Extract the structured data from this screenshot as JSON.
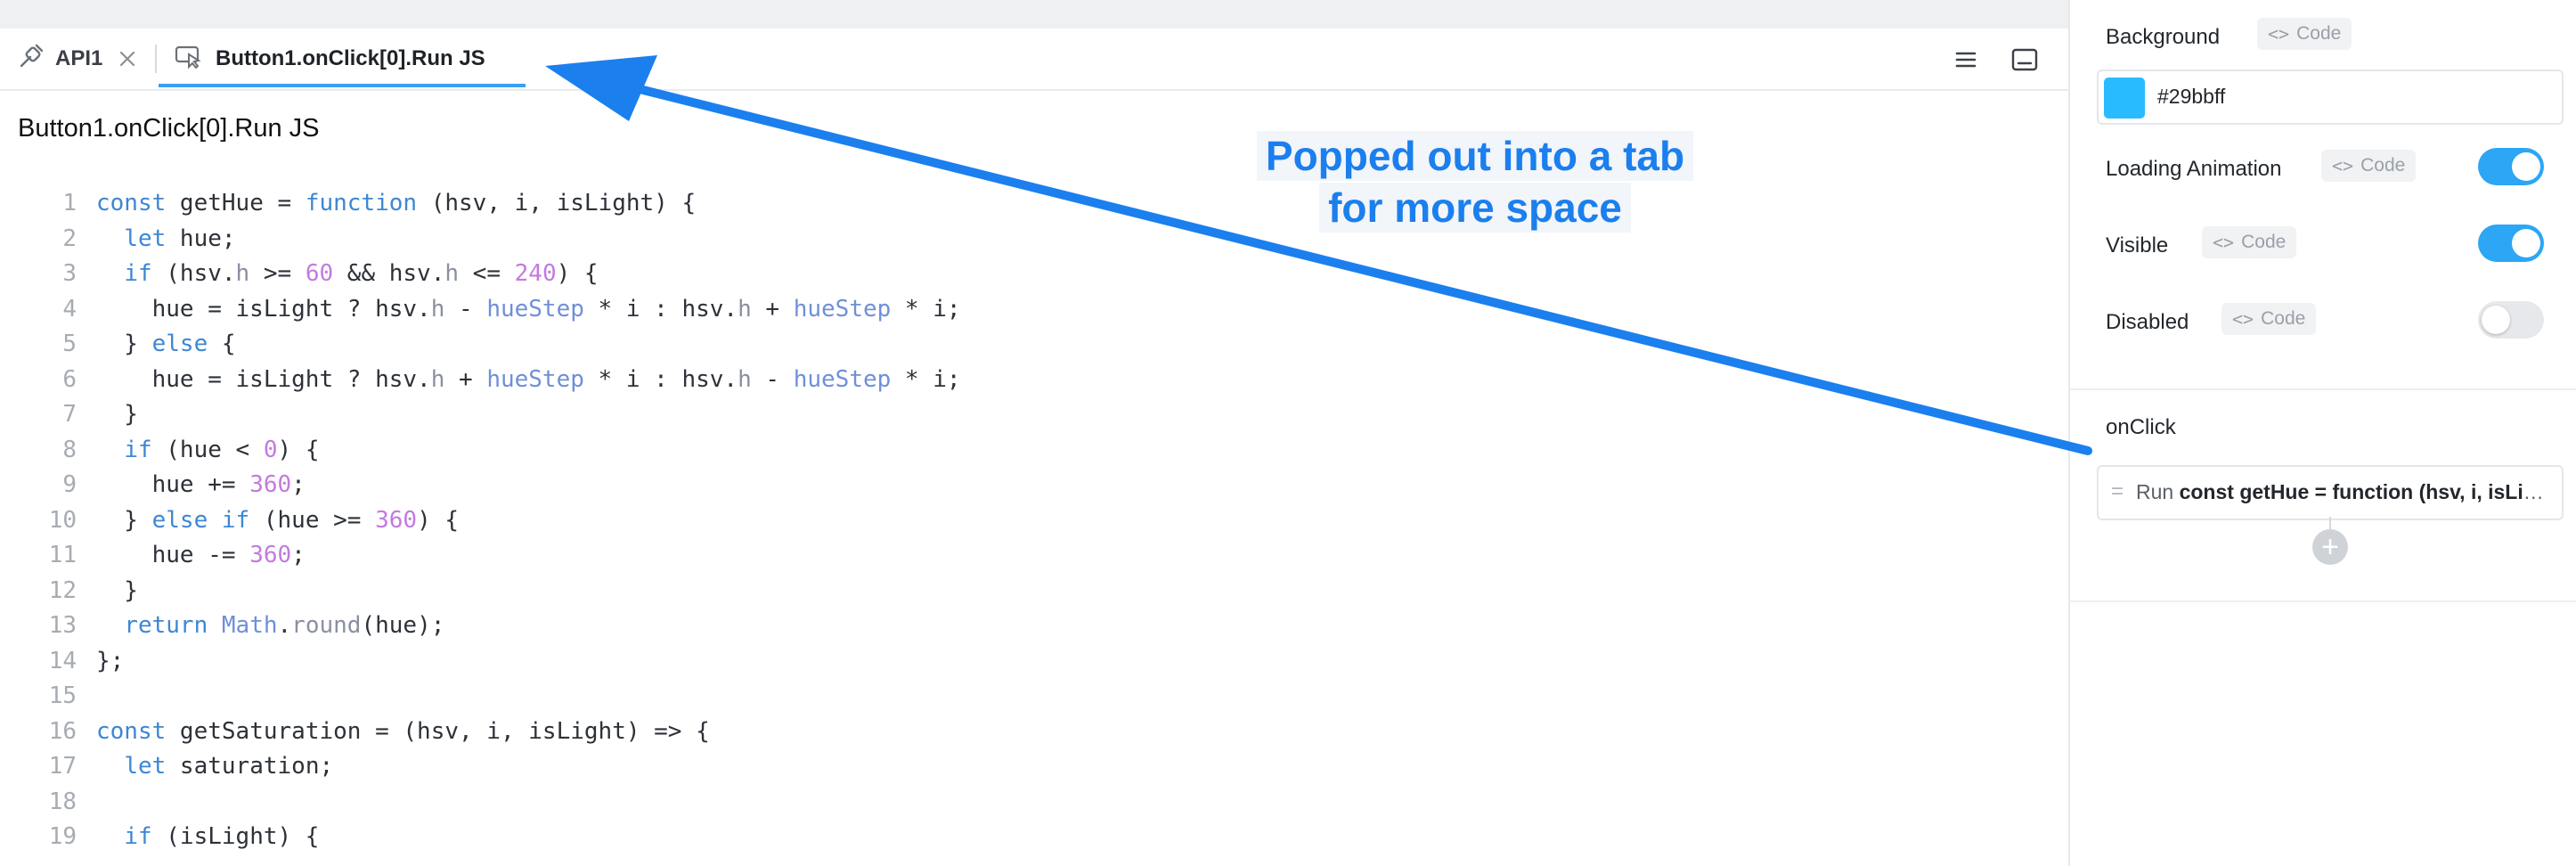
{
  "tabs": [
    {
      "label": "API1",
      "icon": "api-plug-icon",
      "closable": true
    },
    {
      "label": "Button1.onClick[0].Run JS",
      "icon": "pointer-cursor-icon",
      "active": true
    }
  ],
  "toolbar": {
    "icons": [
      "menu-icon",
      "panel-bottom-icon"
    ]
  },
  "editor": {
    "title": "Button1.onClick[0].Run JS",
    "lines": [
      "const getHue = function (hsv, i, isLight) {",
      "  let hue;",
      "  if (hsv.h >= 60 && hsv.h <= 240) {",
      "    hue = isLight ? hsv.h - hueStep * i : hsv.h + hueStep * i;",
      "  } else {",
      "    hue = isLight ? hsv.h + hueStep * i : hsv.h - hueStep * i;",
      "  }",
      "  if (hue < 0) {",
      "    hue += 360;",
      "  } else if (hue >= 360) {",
      "    hue -= 360;",
      "  }",
      "  return Math.round(hue);",
      "};",
      "",
      "const getSaturation = (hsv, i, isLight) => {",
      "  let saturation;",
      "",
      "  if (isLight) {"
    ]
  },
  "properties": {
    "background": {
      "label": "Background",
      "code_label": "Code",
      "value": "#29bbff",
      "swatch": "#29bbff"
    },
    "loading_animation": {
      "label": "Loading Animation",
      "code_label": "Code",
      "on": true
    },
    "visible": {
      "label": "Visible",
      "code_label": "Code",
      "on": true
    },
    "disabled": {
      "label": "Disabled",
      "code_label": "Code",
      "on": false
    }
  },
  "onclick": {
    "label": "onClick",
    "action_prefix": "Run",
    "action_code": "const getHue = function (hsv, i, isLight) {"
  },
  "annotation": {
    "line1": "Popped out into a tab",
    "line2": "for more  space",
    "color": "#1b7fee"
  },
  "colors": {
    "accent": "#2ca6f5",
    "tab_underline": "#3b9ef0"
  }
}
